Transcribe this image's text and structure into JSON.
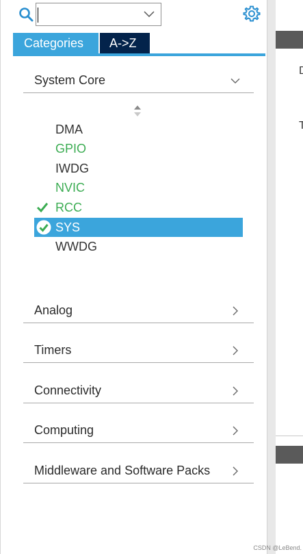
{
  "search": {
    "value": "",
    "placeholder": ""
  },
  "tabs": [
    {
      "label": "Categories"
    },
    {
      "label": "A->Z"
    }
  ],
  "categories": {
    "system_core": {
      "label": "System Core",
      "items": [
        {
          "label": "DMA",
          "status": "default"
        },
        {
          "label": "GPIO",
          "status": "configured"
        },
        {
          "label": "IWDG",
          "status": "default"
        },
        {
          "label": "NVIC",
          "status": "configured"
        },
        {
          "label": "RCC",
          "status": "checked"
        },
        {
          "label": "SYS",
          "status": "selected"
        },
        {
          "label": "WWDG",
          "status": "default"
        }
      ]
    },
    "others": [
      {
        "label": "Analog"
      },
      {
        "label": "Timers"
      },
      {
        "label": "Connectivity"
      },
      {
        "label": "Computing"
      },
      {
        "label": "Middleware and Software Packs"
      }
    ]
  },
  "right_pane": {
    "fragment_1": "D",
    "fragment_2": "T"
  },
  "watermark": "CSDN @LeBend.",
  "colors": {
    "accent": "#3ba5dc",
    "tab_dark": "#03234b",
    "configured": "#3bac52",
    "check": "#3bac52"
  }
}
